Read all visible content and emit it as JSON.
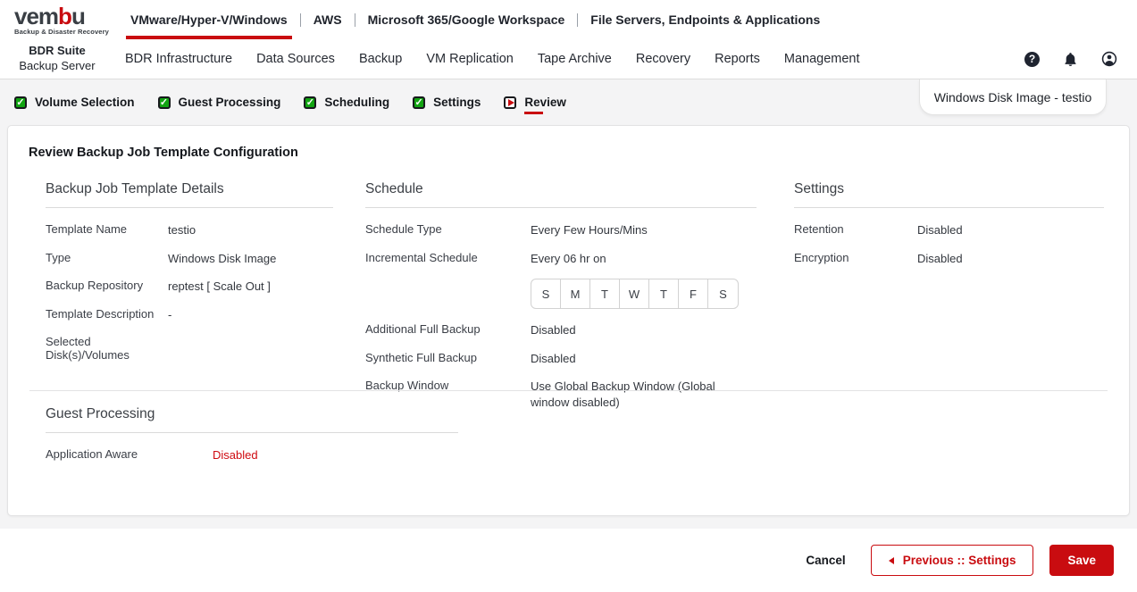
{
  "brand": {
    "logo_part1": "vem",
    "logo_part2": "b",
    "logo_part3": "u",
    "tagline": "Backup & Disaster Recovery",
    "accent_red": "#c90c10",
    "check_green": "#12a412"
  },
  "top_nav": {
    "items": [
      {
        "label": "VMware/Hyper-V/Windows",
        "active": true
      },
      {
        "label": "AWS",
        "active": false
      },
      {
        "label": "Microsoft 365/Google Workspace",
        "active": false
      },
      {
        "label": "File Servers, Endpoints & Applications",
        "active": false
      }
    ]
  },
  "main_nav": {
    "product_line1": "BDR Suite",
    "product_line2": "Backup Server",
    "items": [
      {
        "label": "BDR Infrastructure"
      },
      {
        "label": "Data Sources"
      },
      {
        "label": "Backup"
      },
      {
        "label": "VM Replication"
      },
      {
        "label": "Tape Archive"
      },
      {
        "label": "Recovery"
      },
      {
        "label": "Reports"
      },
      {
        "label": "Management"
      }
    ]
  },
  "wizard": {
    "steps": [
      {
        "label": "Volume Selection",
        "state": "completed"
      },
      {
        "label": "Guest Processing",
        "state": "completed"
      },
      {
        "label": "Scheduling",
        "state": "completed"
      },
      {
        "label": "Settings",
        "state": "completed"
      },
      {
        "label": "Review",
        "state": "current"
      }
    ],
    "tab_label": "Windows Disk Image - testio"
  },
  "review": {
    "page_title": "Review Backup Job Template Configuration",
    "template_details": {
      "heading": "Backup Job Template Details",
      "rows": [
        {
          "label": "Template Name",
          "value": "testio"
        },
        {
          "label": "Type",
          "value": "Windows Disk Image"
        },
        {
          "label": "Backup Repository",
          "value": "reptest [ Scale Out ]"
        },
        {
          "label": "Template Description",
          "value": "-"
        },
        {
          "label": "Selected Disk(s)/Volumes",
          "value": ""
        }
      ]
    },
    "schedule": {
      "heading": "Schedule",
      "schedule_type_label": "Schedule Type",
      "schedule_type_value": "Every Few Hours/Mins",
      "incremental_label": "Incremental Schedule",
      "incremental_value": "Every 06 hr on",
      "week_days": [
        "S",
        "M",
        "T",
        "W",
        "T",
        "F",
        "S"
      ],
      "rows": [
        {
          "label": "Additional Full Backup",
          "value": "Disabled"
        },
        {
          "label": "Synthetic Full Backup",
          "value": "Disabled"
        },
        {
          "label": "Backup Window",
          "value": "Use Global Backup Window  (Global window disabled)"
        }
      ]
    },
    "settings": {
      "heading": "Settings",
      "rows": [
        {
          "label": "Retention",
          "value": "Disabled"
        },
        {
          "label": "Encryption",
          "value": "Disabled"
        }
      ]
    },
    "guest_processing": {
      "heading": "Guest Processing",
      "rows": [
        {
          "label": "Application Aware",
          "value": "Disabled",
          "status_color": "#cf0a10"
        }
      ]
    }
  },
  "footer": {
    "cancel_label": "Cancel",
    "previous_label": "Previous :: Settings",
    "save_label": "Save"
  }
}
